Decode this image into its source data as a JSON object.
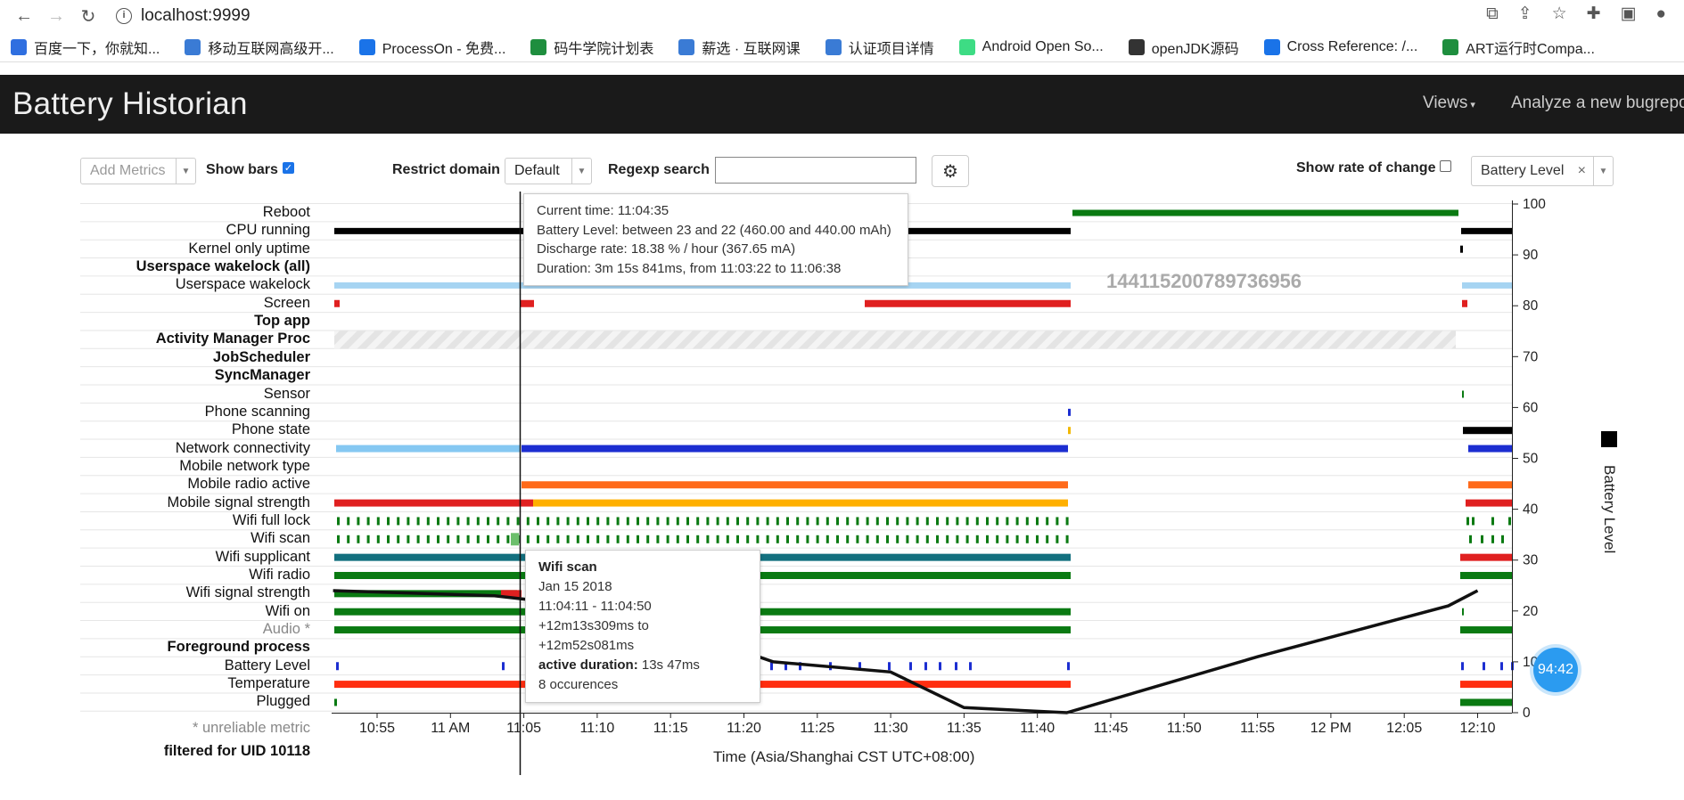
{
  "browser": {
    "url": "localhost:9999",
    "bookmarks": [
      {
        "label": "百度一下，你就知...",
        "color": "#2f6fe0"
      },
      {
        "label": "移动互联网高级开...",
        "color": "#3a7bd5"
      },
      {
        "label": "ProcessOn - 免费...",
        "color": "#1a73e8"
      },
      {
        "label": "码牛学院计划表",
        "color": "#1e8e3e"
      },
      {
        "label": "薪选 · 互联网课",
        "color": "#3a7bd5"
      },
      {
        "label": "认证项目详情",
        "color": "#3a7bd5"
      },
      {
        "label": "Android Open So...",
        "color": "#3ddc84"
      },
      {
        "label": "openJDK源码",
        "color": "#333333"
      },
      {
        "label": "Cross Reference: /...",
        "color": "#1a73e8"
      },
      {
        "label": "ART运行时Compa...",
        "color": "#1e8e3e"
      }
    ]
  },
  "app": {
    "title": "Battery Historian",
    "views_label": "Views",
    "analyze_label": "Analyze a new bugreport"
  },
  "controls": {
    "add_metrics_placeholder": "Add Metrics",
    "show_bars_label": "Show bars",
    "show_bars_checked": true,
    "restrict_domain_label": "Restrict domain",
    "restrict_domain_value": "Default",
    "regexp_label": "Regexp search",
    "regexp_value": "",
    "show_rate_label": "Show rate of change",
    "show_rate_checked": false,
    "metric_select_value": "Battery Level"
  },
  "rows": [
    {
      "label": "Reboot",
      "style": "normal"
    },
    {
      "label": "CPU running",
      "style": "normal"
    },
    {
      "label": "Kernel only uptime",
      "style": "normal"
    },
    {
      "label": "Userspace wakelock (all)",
      "style": "bold"
    },
    {
      "label": "Userspace wakelock",
      "style": "normal"
    },
    {
      "label": "Screen",
      "style": "normal"
    },
    {
      "label": "Top app",
      "style": "bold"
    },
    {
      "label": "Activity Manager Proc",
      "style": "bold"
    },
    {
      "label": "JobScheduler",
      "style": "bold"
    },
    {
      "label": "SyncManager",
      "style": "bold"
    },
    {
      "label": "Sensor",
      "style": "normal"
    },
    {
      "label": "Phone scanning",
      "style": "normal"
    },
    {
      "label": "Phone state",
      "style": "normal"
    },
    {
      "label": "Network connectivity",
      "style": "normal"
    },
    {
      "label": "Mobile network type",
      "style": "normal"
    },
    {
      "label": "Mobile radio active",
      "style": "normal"
    },
    {
      "label": "Mobile signal strength",
      "style": "normal"
    },
    {
      "label": "Wifi full lock",
      "style": "normal"
    },
    {
      "label": "Wifi scan",
      "style": "normal"
    },
    {
      "label": "Wifi supplicant",
      "style": "normal"
    },
    {
      "label": "Wifi radio",
      "style": "normal"
    },
    {
      "label": "Wifi signal strength",
      "style": "normal"
    },
    {
      "label": "Wifi on",
      "style": "normal"
    },
    {
      "label": "Audio *",
      "style": "gray"
    },
    {
      "label": "Foreground process",
      "style": "bold"
    },
    {
      "label": "Battery Level",
      "style": "normal"
    },
    {
      "label": "Temperature",
      "style": "normal"
    },
    {
      "label": "Plugged",
      "style": "normal"
    }
  ],
  "footnotes": {
    "unreliable": "* unreliable metric",
    "filtered": "filtered for UID 10118"
  },
  "x_axis": {
    "ticks": [
      "10:55",
      "11 AM",
      "11:05",
      "11:10",
      "11:15",
      "11:20",
      "11:25",
      "11:30",
      "11:35",
      "11:40",
      "11:45",
      "11:50",
      "11:55",
      "12 PM",
      "12:05",
      "12:10"
    ],
    "label": "Time (Asia/Shanghai CST UTC+08:00)"
  },
  "y_axis": {
    "ticks": [
      "100",
      "90",
      "80",
      "70",
      "60",
      "50",
      "40",
      "30",
      "20",
      "10",
      "0"
    ],
    "label": "Battery Level"
  },
  "watermark": "144115200789736956",
  "tooltip_top": {
    "current_time": "Current time: 11:04:35",
    "battery_level": "Battery Level: between 23 and 22 (460.00 and 440.00 mAh)",
    "discharge_rate": "Discharge rate: 18.38 % / hour (367.65 mA)",
    "duration": "Duration: 3m 15s 841ms, from 11:03:22 to 11:06:38"
  },
  "tooltip_wifi": {
    "title": "Wifi scan",
    "date": "Jan 15 2018",
    "range": "11:04:11 - 11:04:50",
    "offset": "+12m13s309ms to +12m52s081ms",
    "active_label": "active duration:",
    "active_value": "13s 47ms",
    "occurrences": "8 occurences"
  },
  "floater": "94:42",
  "chart_data": {
    "type": "line",
    "title": "",
    "xlabel": "Time (Asia/Shanghai CST UTC+08:00)",
    "ylabel": "Battery Level",
    "ylim": [
      0,
      100
    ],
    "series": [
      {
        "name": "Battery Level",
        "x": [
          "10:52",
          "11:03",
          "11:06",
          "11:18",
          "11:22",
          "11:30",
          "11:35",
          "11:42",
          "11:55",
          "12:08",
          "12:10"
        ],
        "values": [
          24,
          23,
          22,
          14,
          10,
          8,
          1,
          0,
          11,
          21,
          24
        ]
      }
    ]
  }
}
